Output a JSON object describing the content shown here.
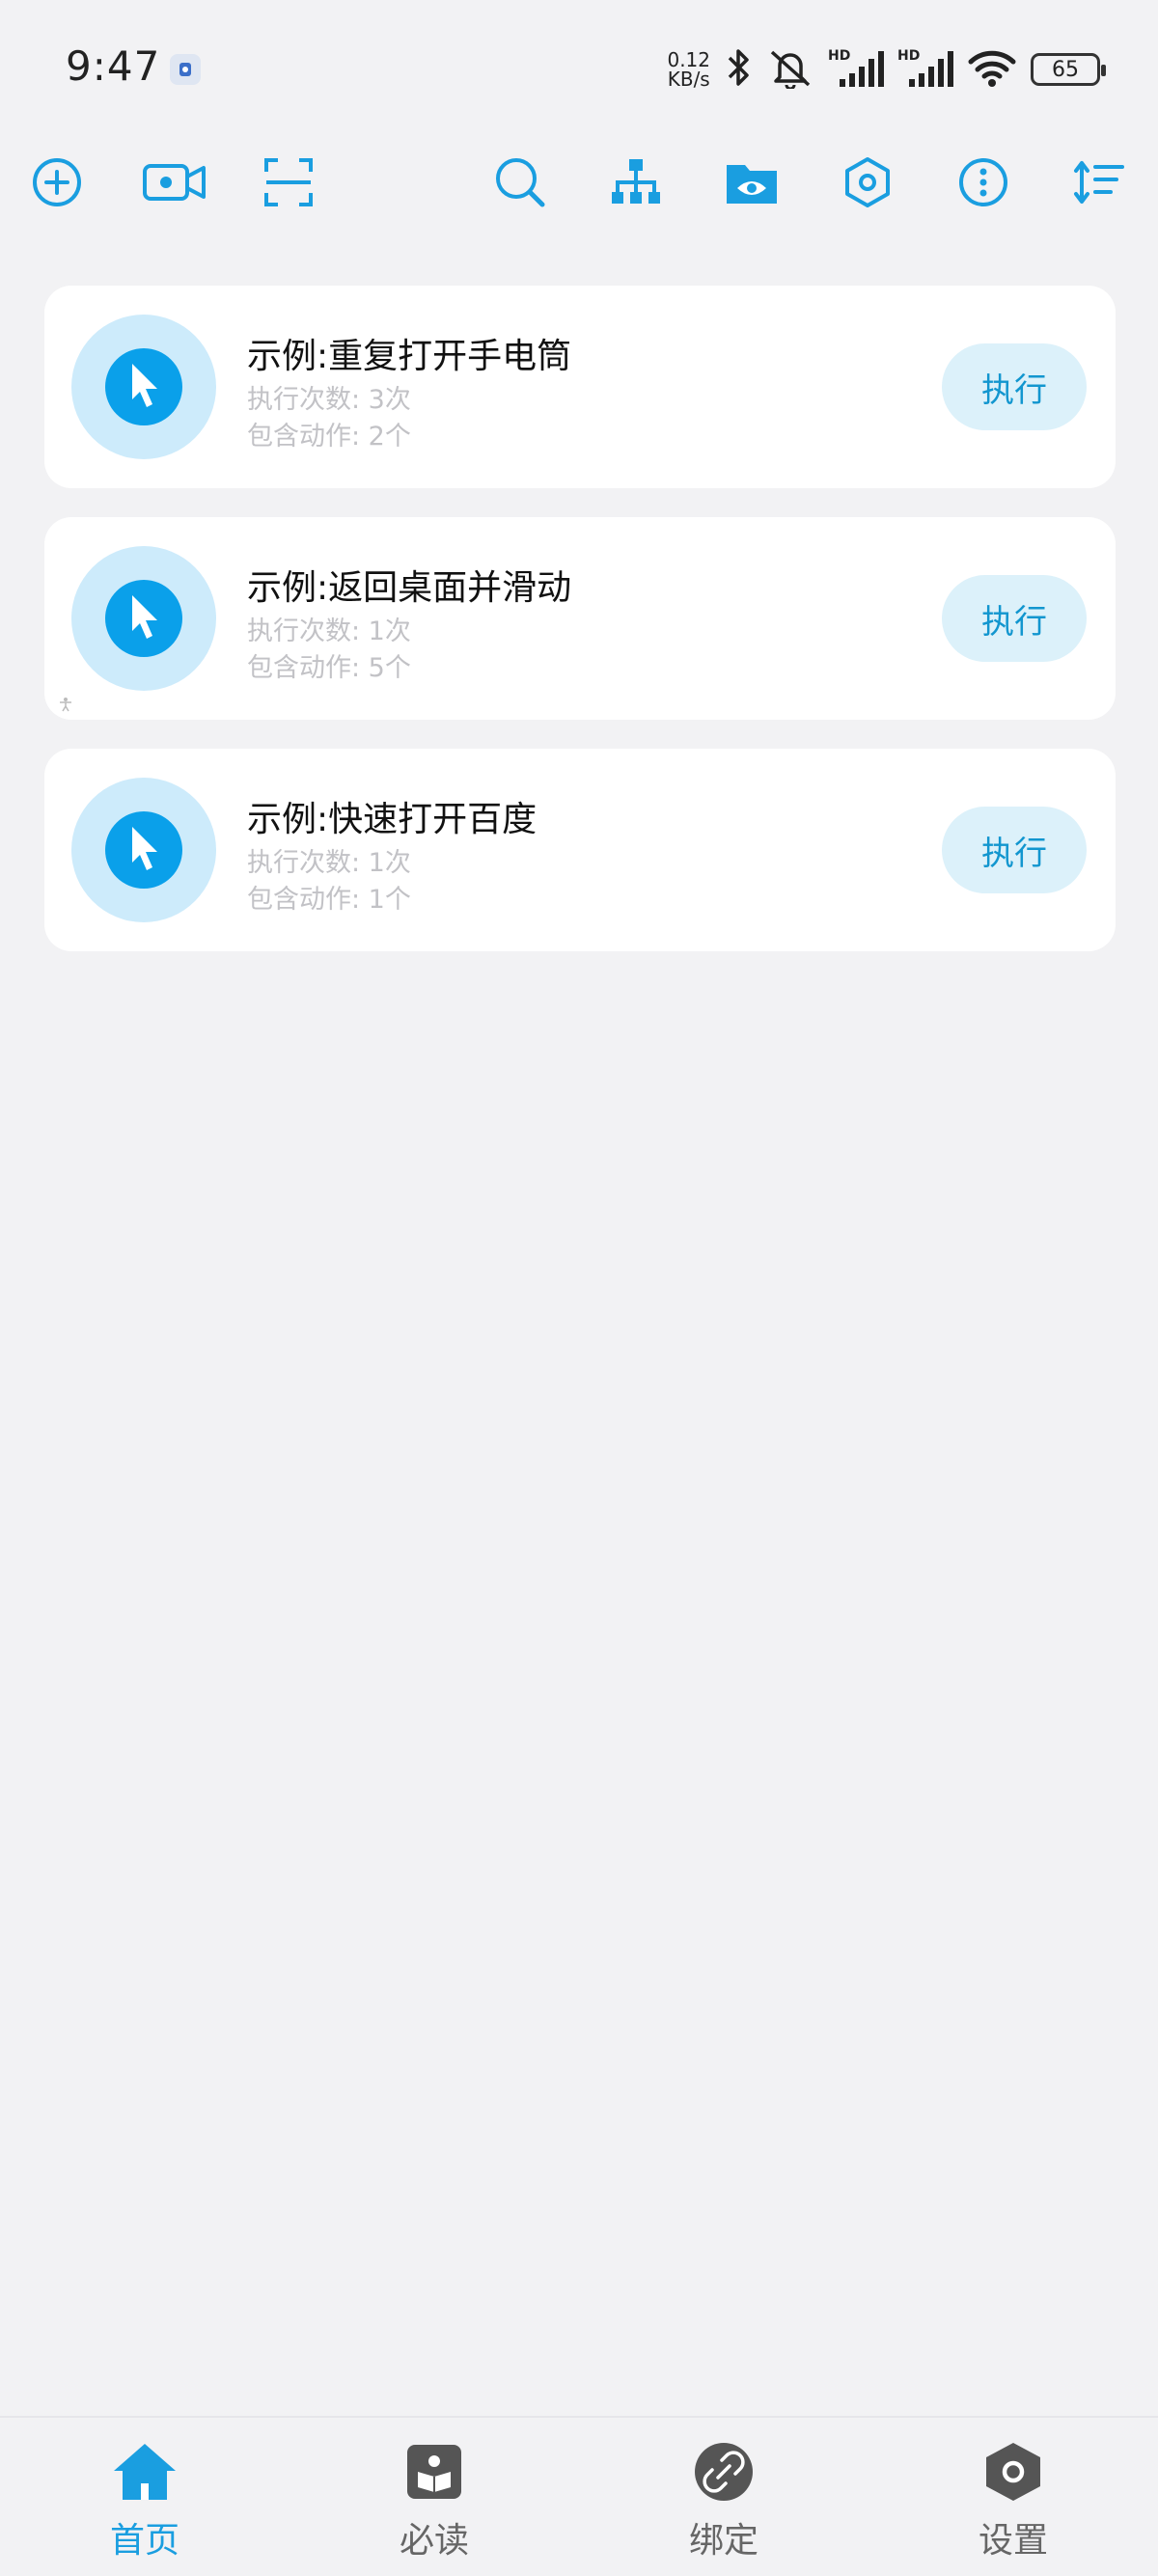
{
  "status_bar": {
    "time": "9:47",
    "net_speed_value": "0.12",
    "net_speed_unit": "KB/s",
    "battery": "65",
    "icons": [
      "bluetooth-icon",
      "mute-icon",
      "signal-hd-1-icon",
      "signal-hd-2-icon",
      "wifi-icon"
    ]
  },
  "toolbar": {
    "icons": [
      "add-circle-icon",
      "video-record-icon",
      "scan-frame-icon",
      "search-icon",
      "sitemap-icon",
      "folder-eye-icon",
      "hexagon-settings-icon",
      "more-vertical-icon",
      "sort-icon"
    ]
  },
  "tasks": [
    {
      "title": "示例:重复打开手电筒",
      "run_count": "执行次数: 3次",
      "action_count": "包含动作: 2个",
      "exec_label": "执行"
    },
    {
      "title": "示例:返回桌面并滑动",
      "run_count": "执行次数: 1次",
      "action_count": "包含动作: 5个",
      "exec_label": "执行"
    },
    {
      "title": "示例:快速打开百度",
      "run_count": "执行次数: 1次",
      "action_count": "包含动作: 1个",
      "exec_label": "执行"
    }
  ],
  "bottom_nav": {
    "items": [
      {
        "label": "首页",
        "icon": "home-icon",
        "active": true
      },
      {
        "label": "必读",
        "icon": "book-icon",
        "active": false
      },
      {
        "label": "绑定",
        "icon": "link-icon",
        "active": false
      },
      {
        "label": "设置",
        "icon": "settings-icon",
        "active": false
      }
    ]
  },
  "colors": {
    "accent": "#1a9ee0",
    "card_bg": "#ffffff",
    "page_bg": "#f2f2f4",
    "exec_bg": "#dcf1fa"
  }
}
